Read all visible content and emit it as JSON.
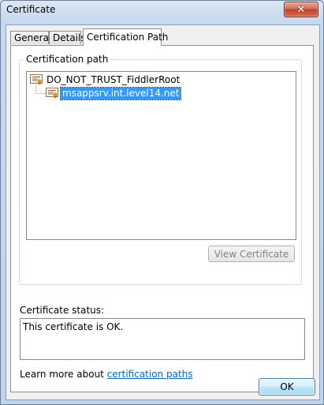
{
  "window": {
    "title": "Certificate",
    "close_glyph": "✕"
  },
  "tabs": [
    {
      "label": "General",
      "active": false
    },
    {
      "label": "Details",
      "active": false
    },
    {
      "label": "Certification Path",
      "active": true
    }
  ],
  "certification_path": {
    "group_label": "Certification path",
    "nodes": [
      {
        "label": "DO_NOT_TRUST_FiddlerRoot",
        "icon": "certificate-icon",
        "selected": false
      },
      {
        "label": "msappsrv.int.level14.net",
        "icon": "certificate-warning-icon",
        "selected": true
      }
    ],
    "view_button_label": "View Certificate"
  },
  "status": {
    "label": "Certificate status:",
    "text": "This certificate is OK."
  },
  "learn_more": {
    "prefix": "Learn more about ",
    "link_text": "certification paths"
  },
  "footer": {
    "ok_label": "OK"
  },
  "colors": {
    "selection": "#3399ff",
    "link": "#0066cc",
    "close_button": "#c24128"
  }
}
